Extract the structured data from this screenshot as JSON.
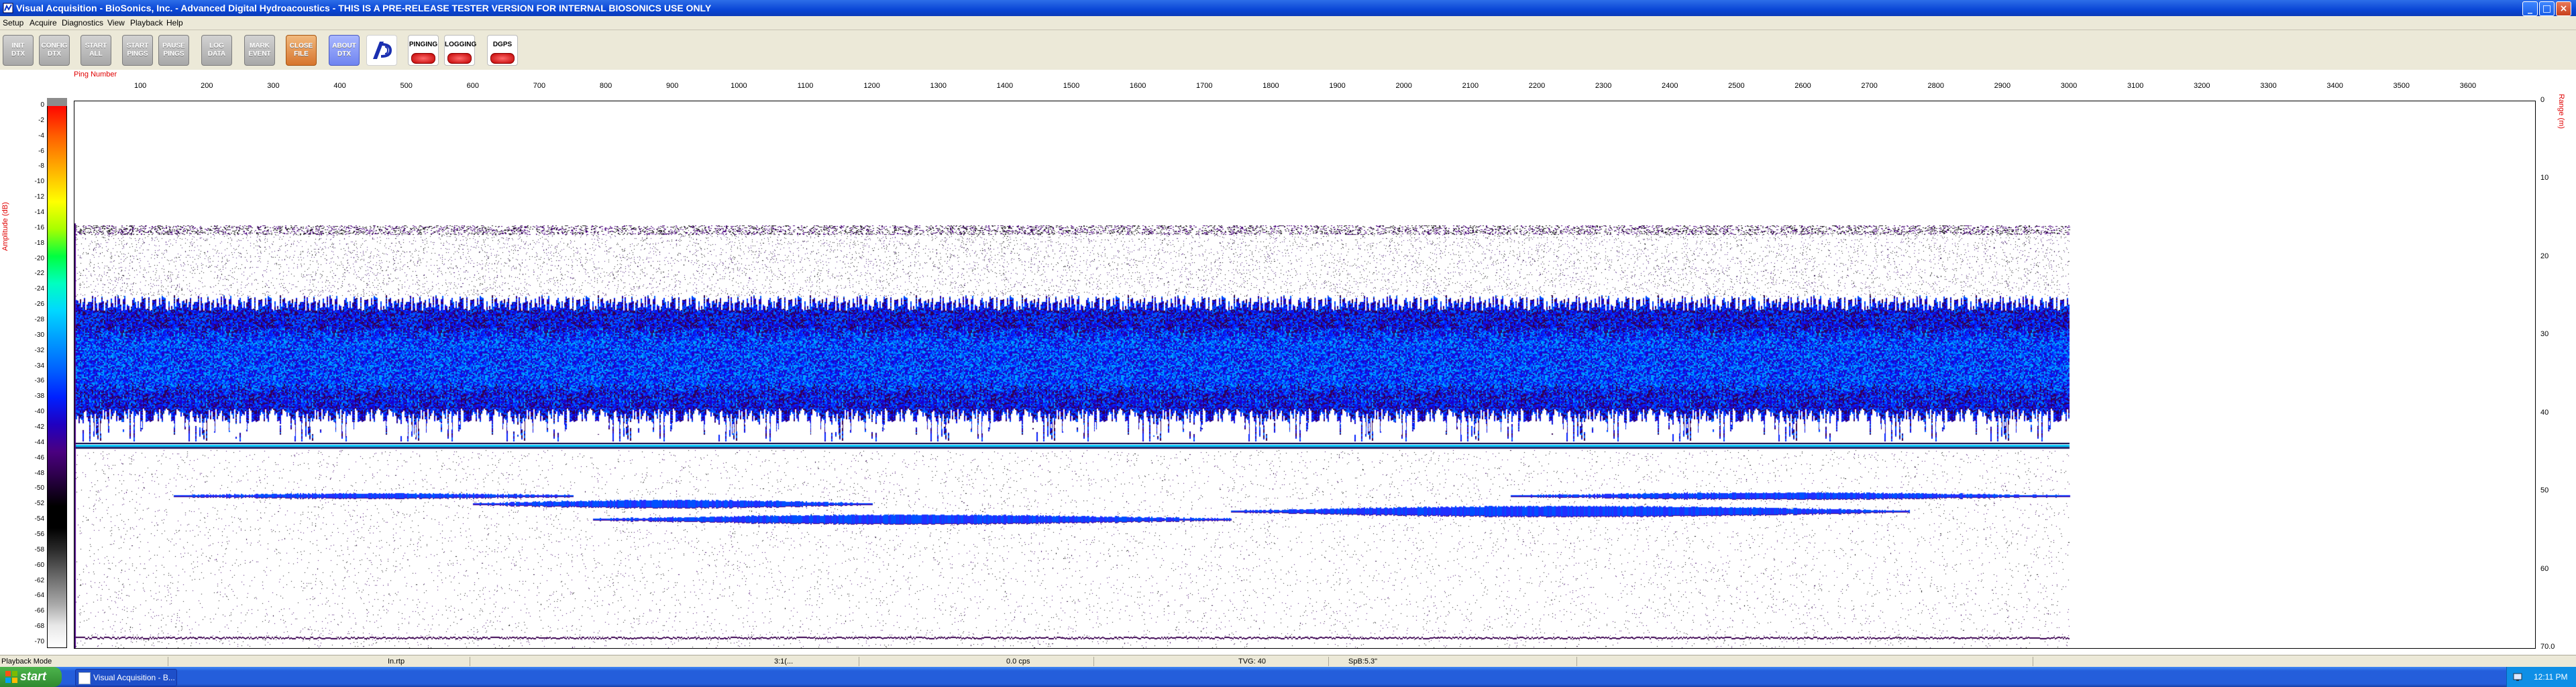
{
  "window": {
    "title": "Visual Acquisition  -  BioSonics, Inc.  -  Advanced Digital Hydroacoustics  -  THIS IS A PRE-RELEASE TESTER VERSION FOR INTERNAL BIOSONICS USE ONLY",
    "controls": {
      "minimize": "_",
      "maximize": "□",
      "close": "×"
    }
  },
  "menu": [
    "Setup",
    "Acquire",
    "Diagnostics",
    "View",
    "Playback",
    "Help"
  ],
  "toolbar": {
    "buttons": [
      {
        "label": "INIT\nDTX",
        "style": "gray"
      },
      {
        "label": "CONFIG\nDTX",
        "style": "gray"
      },
      {
        "label": "START\nALL",
        "style": "gray"
      },
      {
        "label": "START\nPINGS",
        "style": "gray"
      },
      {
        "label": "PAUSE\nPINGS",
        "style": "gray"
      },
      {
        "label": "LOG\nDATA",
        "style": "gray"
      },
      {
        "label": "MARK\nEVENT",
        "style": "gray"
      },
      {
        "label": "CLOSE\nFILE",
        "style": "orange"
      },
      {
        "label": "ABOUT\nDTX",
        "style": "blue"
      }
    ],
    "status": [
      {
        "label": "PINGING",
        "led_color": "#cc0000"
      },
      {
        "label": "LOGGING",
        "led_color": "#cc0000"
      },
      {
        "label": "DGPS",
        "led_color": "#cc0000"
      }
    ]
  },
  "colorbar": {
    "label": "Amplitude (dB)",
    "ticks": [
      "0",
      "-2",
      "-4",
      "-6",
      "-8",
      "-10",
      "-12",
      "-14",
      "-16",
      "-18",
      "-20",
      "-22",
      "-24",
      "-26",
      "-28",
      "-30",
      "-32",
      "-34",
      "-36",
      "-38",
      "-40",
      "-42",
      "-44",
      "-46",
      "-48",
      "-50",
      "-52",
      "-54",
      "-56",
      "-58",
      "-60",
      "-62",
      "-64",
      "-66",
      "-68",
      "-70"
    ]
  },
  "echogram": {
    "x_label": "Ping Number",
    "x_ticks": [
      "100",
      "200",
      "300",
      "400",
      "500",
      "600",
      "700",
      "800",
      "900",
      "1000",
      "1100",
      "1200",
      "1300",
      "1400",
      "1500",
      "1600",
      "1700",
      "1800",
      "1900",
      "2000",
      "2100",
      "2200",
      "2300",
      "2400",
      "2500",
      "2600",
      "2700",
      "2800",
      "2900",
      "3000",
      "3100",
      "3200",
      "3300",
      "3400",
      "3500",
      "3600"
    ],
    "x_max": 3700,
    "data_end_ping": 3000,
    "y_label": "Range (m)",
    "y_ticks": [
      "0",
      "10",
      "20",
      "30",
      "40",
      "50",
      "60",
      "70.0"
    ],
    "y_max": 70,
    "layers": [
      {
        "type": "surface-noise",
        "range_m": 16.5
      },
      {
        "type": "dense-school",
        "range_m": [
          25.5,
          41
        ]
      },
      {
        "type": "bottom-line",
        "range_m": 44
      }
    ]
  },
  "statusbar": {
    "fields": [
      "Playback Mode",
      "In.rtp",
      "3:1(...",
      "0.0 cps",
      "TVG: 40",
      "SpB:5.3\""
    ]
  },
  "taskbar": {
    "start_label": "start",
    "task_label": "Visual Acquisition - B...",
    "clock": "12:11 PM"
  }
}
